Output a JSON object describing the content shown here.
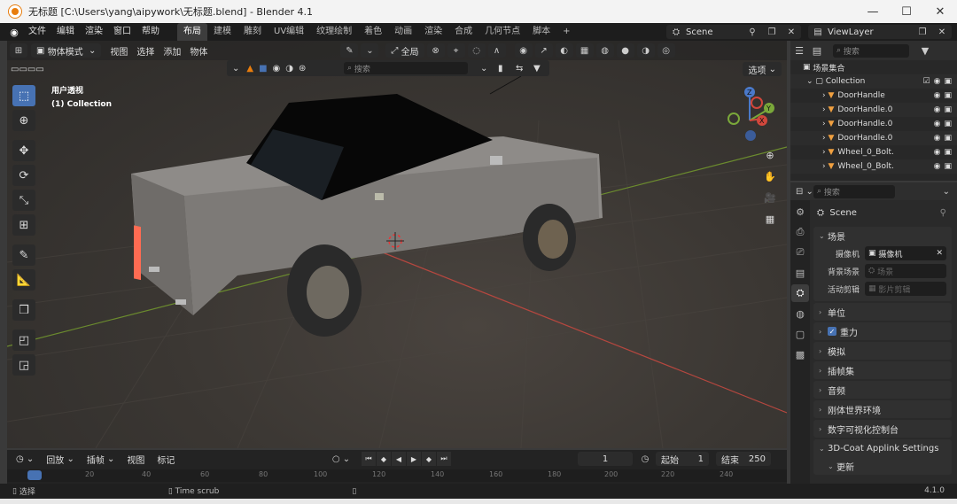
{
  "window": {
    "title": "无标题 [C:\\Users\\yang\\aipywork\\无标题.blend] - Blender 4.1",
    "controls": [
      "—",
      "☐",
      "✕"
    ]
  },
  "topbar": {
    "menus": [
      "文件",
      "编辑",
      "渲染",
      "窗口",
      "帮助"
    ],
    "workspaces": [
      "布局",
      "建模",
      "雕刻",
      "UV编辑",
      "纹理绘制",
      "着色",
      "动画",
      "渲染",
      "合成",
      "几何节点",
      "脚本",
      "+"
    ],
    "active_workspace": "布局",
    "scene": "Scene",
    "view_layer": "ViewLayer"
  },
  "viewport": {
    "mode": "物体模式",
    "menus": [
      "视图",
      "选择",
      "添加",
      "物体"
    ],
    "transform": "全局",
    "search_placeholder": "搜索",
    "options_label": "选项",
    "info_line1": "用户透视",
    "info_line2": "(1) Collection"
  },
  "toolbar": {
    "tools": [
      "select-box",
      "cursor",
      "move",
      "rotate",
      "scale",
      "transform",
      "annotate",
      "measure",
      "add-cube",
      "shrink",
      "extrude"
    ]
  },
  "timeline": {
    "menus": [
      "回放",
      "插帧",
      "视图",
      "标记"
    ],
    "current_frame": "1",
    "start_label": "起始",
    "start_value": "1",
    "end_label": "结束",
    "end_value": "250",
    "ticks": [
      "20",
      "40",
      "60",
      "80",
      "100",
      "120",
      "140",
      "160",
      "180",
      "200",
      "220",
      "240"
    ]
  },
  "statusbar": {
    "left": "选择",
    "middle": "Time scrub",
    "version": "4.1.0"
  },
  "outliner": {
    "search_placeholder": "搜索",
    "scene_collection": "场景集合",
    "collection": "Collection",
    "items": [
      "DoorHandle",
      "DoorHandle.0",
      "DoorHandle.0",
      "DoorHandle.0",
      "Wheel_0_Bolt.",
      "Wheel_0_Bolt."
    ]
  },
  "properties": {
    "search_placeholder": "搜索",
    "title": "Scene",
    "scene_panel": {
      "header": "场景",
      "camera_label": "摄像机",
      "camera_value": "摄像机",
      "background_label": "背景场景",
      "background_placeholder": "场景",
      "clip_label": "活动剪辑",
      "clip_placeholder": "影片剪辑"
    },
    "panels": [
      "单位",
      "重力",
      "模拟",
      "插帧集",
      "音频",
      "刚体世界环境",
      "数字可视化控制台",
      "3D-Coat Applink Settings"
    ],
    "subpanel": "更新"
  },
  "colors": {
    "accent": "#4772b3",
    "orange": "#e87d0d"
  }
}
